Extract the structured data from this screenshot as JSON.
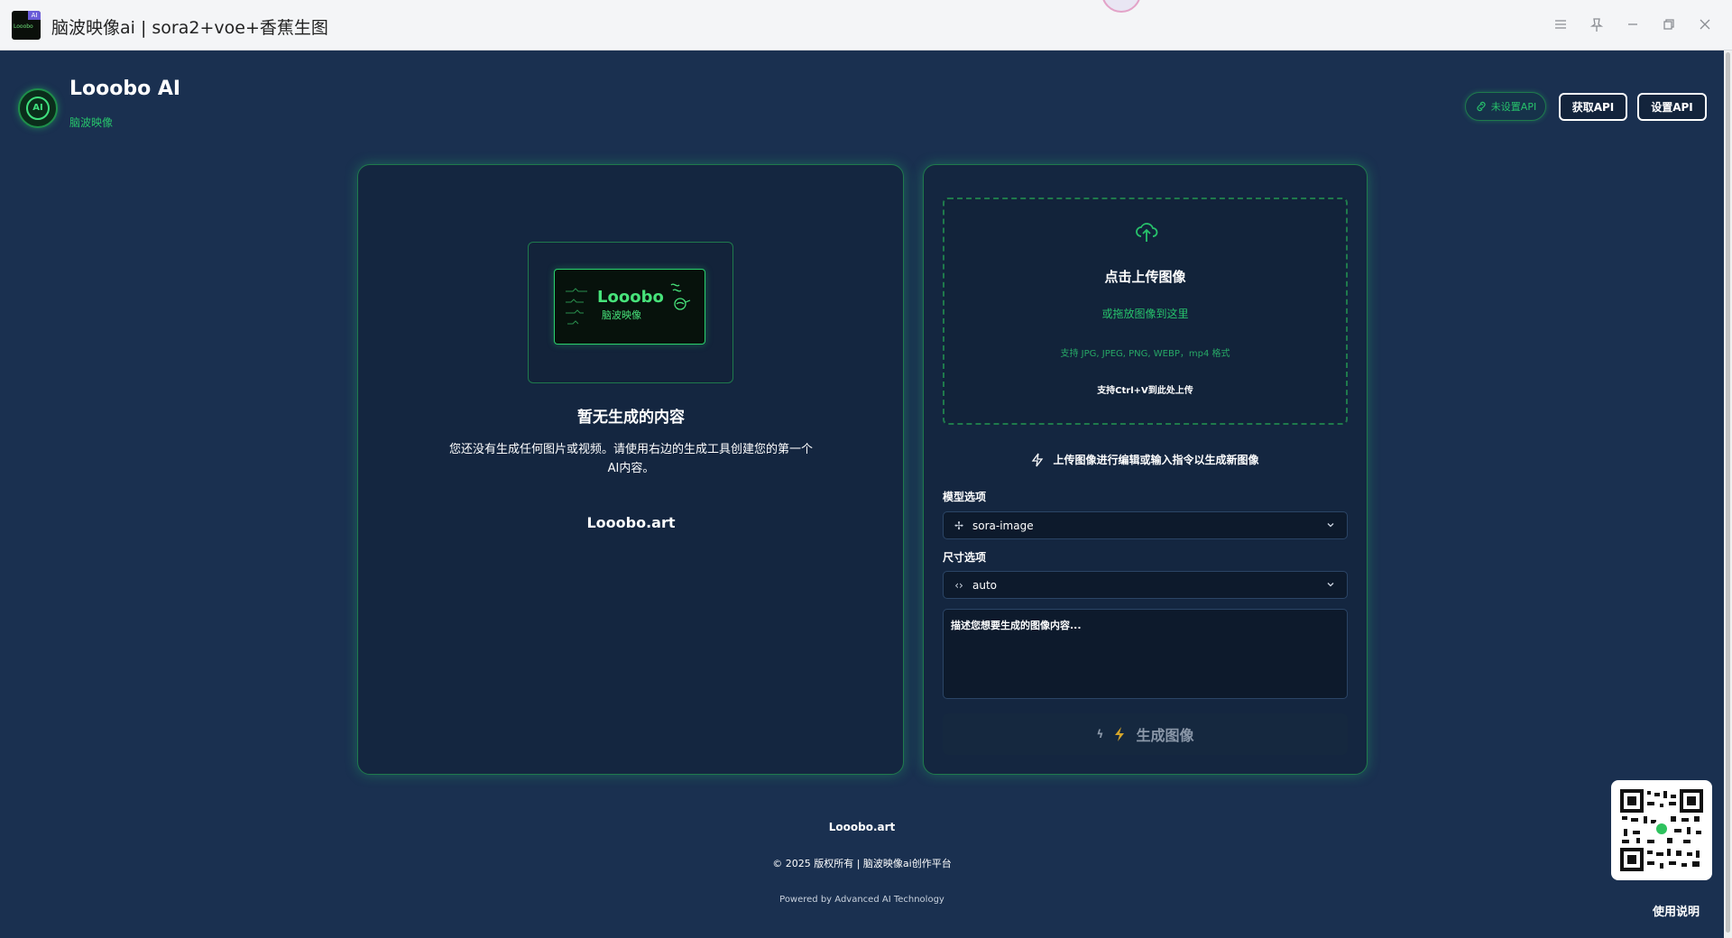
{
  "window": {
    "title": "脑波映像ai | sora2+voe+香蕉生图",
    "icon_tag": "AI",
    "icon_brand": "Looobo",
    "controls": [
      "menu-icon",
      "pin-icon",
      "minimize-icon",
      "restore-icon",
      "close-icon"
    ]
  },
  "header": {
    "logo_text": "AI",
    "brand": "Looobo AI",
    "subtitle": "脑波映像",
    "api_status": "未设置API",
    "get_api": "获取API",
    "set_api": "设置API"
  },
  "left_panel": {
    "preview_logo": "Looobo",
    "preview_sub": "脑波映像",
    "empty_title": "暂无生成的内容",
    "empty_desc": "您还没有生成任何图片或视频。请使用右边的生成工具创建您的第一个AI内容。",
    "site": "Looobo.art"
  },
  "right_panel": {
    "upload": {
      "title": "点击上传图像",
      "drag": "或拖放图像到这里",
      "formats": "支持 JPG, JPEG, PNG, WEBP，mp4 格式",
      "paste": "支持Ctrl+V到此处上传"
    },
    "hint": "上传图像进行编辑或输入指令以生成新图像",
    "model": {
      "label": "模型选项",
      "value": "sora-image"
    },
    "size": {
      "label": "尺寸选项",
      "value": "auto"
    },
    "prompt_placeholder": "描述您想要生成的图像内容...",
    "generate": "生成图像"
  },
  "footer": {
    "site": "Looobo.art",
    "copyright": "© 2025 版权所有 | 脑波映像ai创作平台",
    "powered": "Powered by Advanced AI Technology"
  },
  "help": "使用说明",
  "colors": {
    "background": "#1a3050",
    "panel": "#142640",
    "accent_green": "#27c26b",
    "border_green": "#1f7a4c"
  }
}
